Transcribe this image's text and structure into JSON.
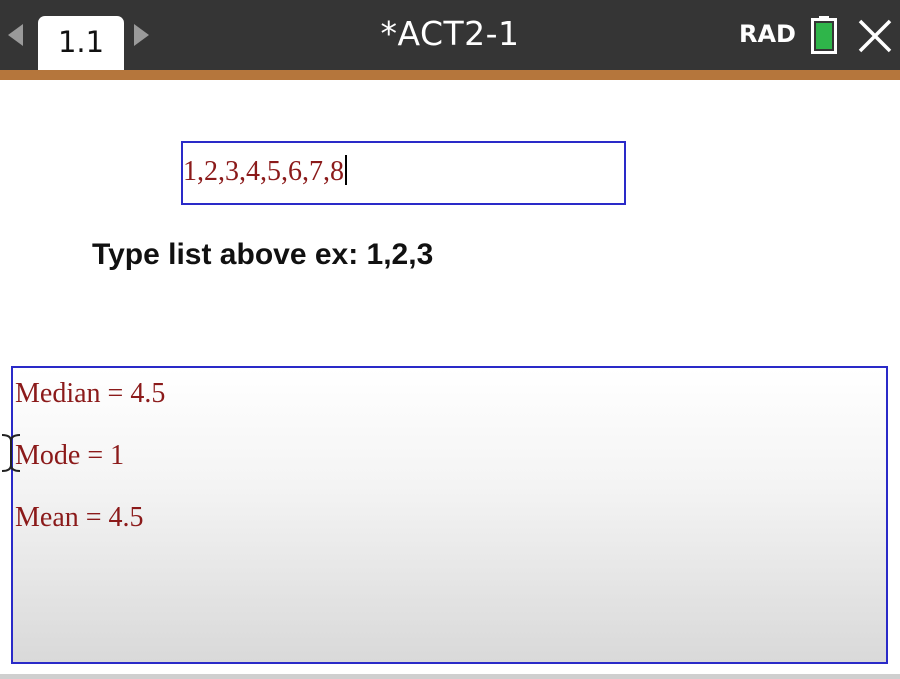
{
  "header": {
    "tab_label": "1.1",
    "document_title": "*ACT2-1",
    "angle_mode": "RAD",
    "battery_icon": "battery-icon",
    "close_icon": "close-icon",
    "prev_icon": "chevron-left-icon",
    "next_icon": "chevron-right-icon"
  },
  "colors": {
    "topbar": "#353535",
    "accent_stripe": "#b5763c",
    "box_border": "#2a2ac8",
    "math_text": "#8b1a1a",
    "battery_fill": "#2fb54a"
  },
  "input": {
    "value": "1,2,3,4,5,6,7,8"
  },
  "instruction": "Type list above ex: 1,2,3",
  "output": {
    "median": "Median = 4.5",
    "mode": "Mode = 1",
    "mean": "Mean = 4.5"
  }
}
